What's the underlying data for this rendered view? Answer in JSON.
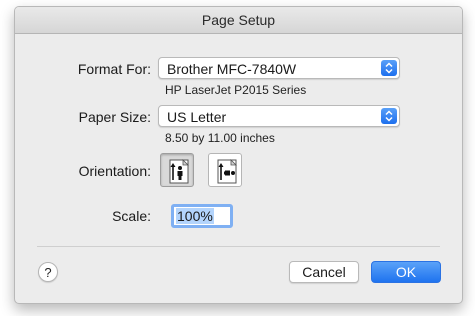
{
  "window": {
    "title": "Page Setup"
  },
  "format_for": {
    "label": "Format For:",
    "selected": "Brother MFC-7840W",
    "subtitle": "HP LaserJet P2015 Series"
  },
  "paper_size": {
    "label": "Paper Size:",
    "selected": "US Letter",
    "subtitle": "8.50 by 11.00 inches"
  },
  "orientation": {
    "label": "Orientation:",
    "options": [
      {
        "name": "portrait",
        "icon": "portrait-orientation-icon",
        "selected": true
      },
      {
        "name": "landscape",
        "icon": "landscape-orientation-icon",
        "selected": false
      }
    ]
  },
  "scale": {
    "label": "Scale:",
    "value": "100%"
  },
  "footer": {
    "help_label": "?",
    "cancel_label": "Cancel",
    "ok_label": "OK"
  },
  "colors": {
    "accent": "#1f73ef",
    "focus_ring": "#7fb0f3",
    "selection": "#b3d4fc"
  }
}
